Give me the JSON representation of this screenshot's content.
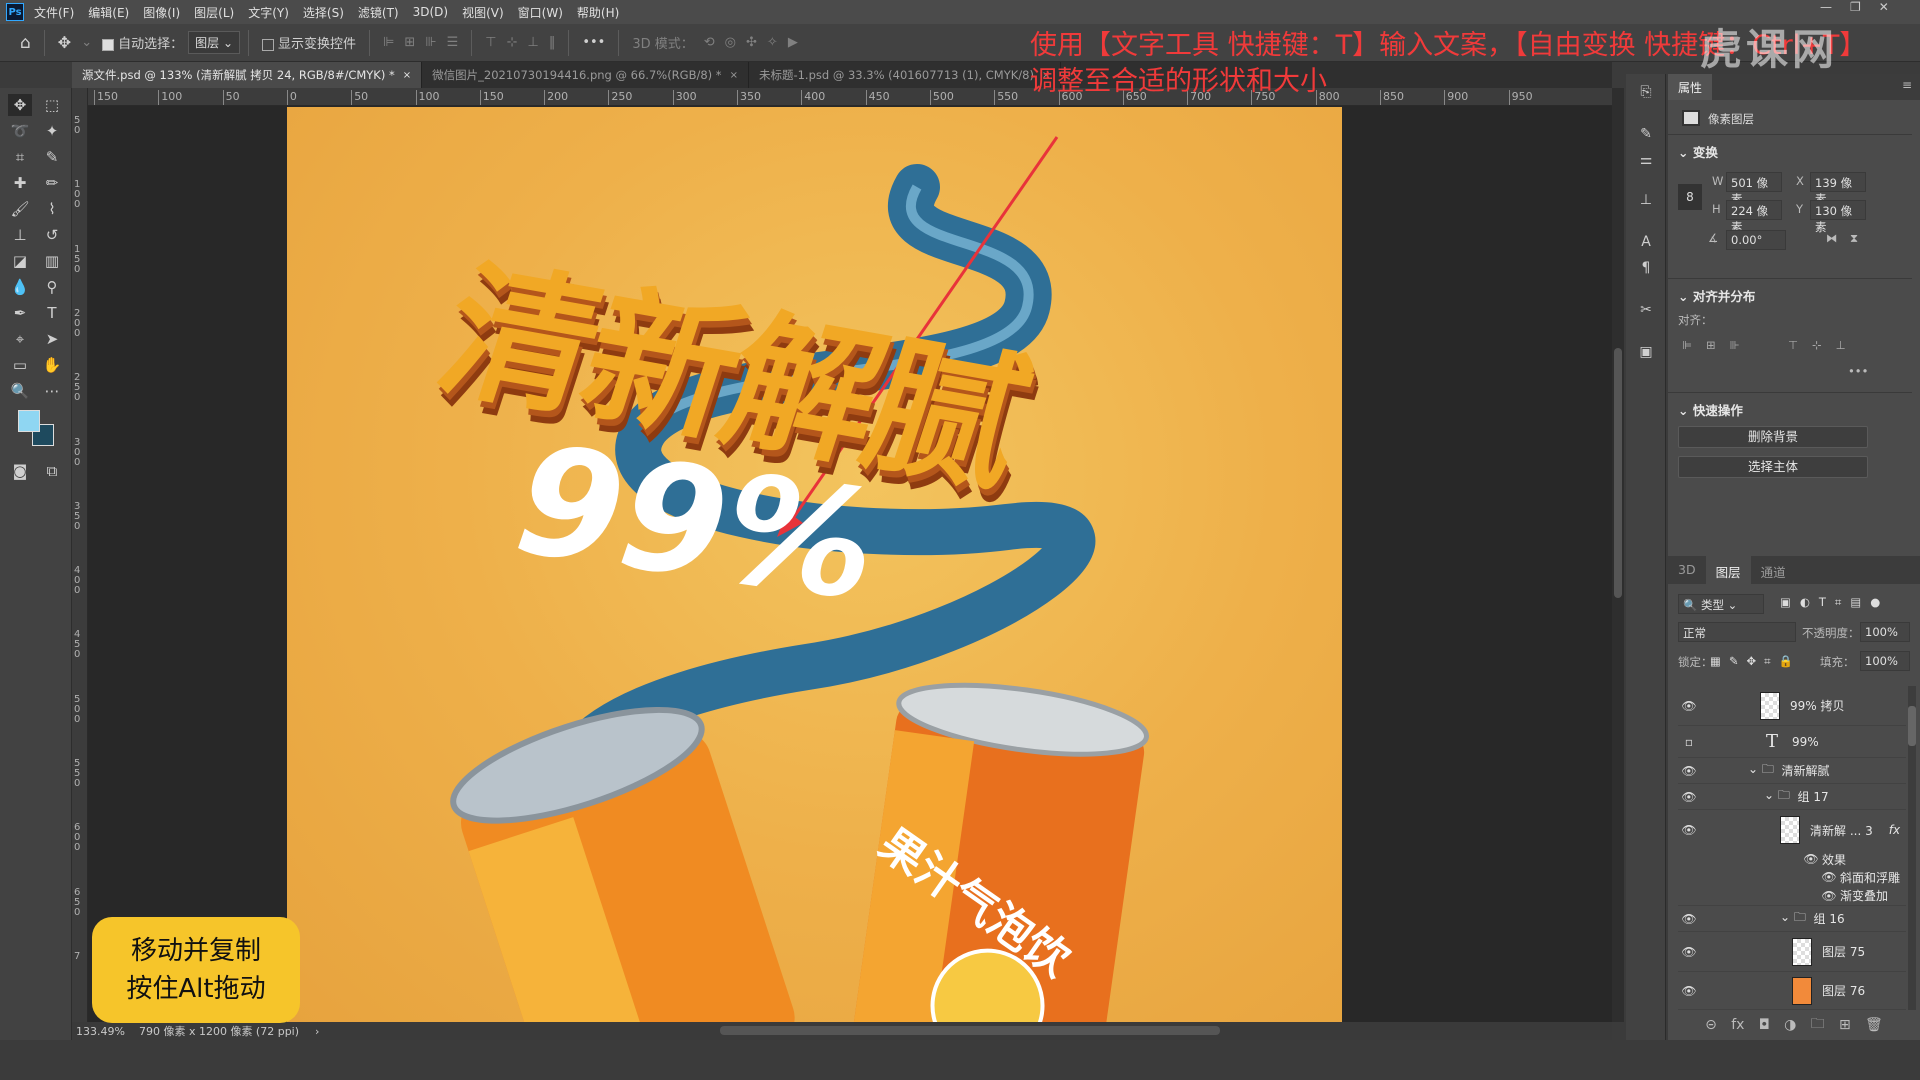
{
  "app": {
    "logo": "Ps"
  },
  "menu": [
    "文件(F)",
    "编辑(E)",
    "图像(I)",
    "图层(L)",
    "文字(Y)",
    "选择(S)",
    "滤镜(T)",
    "3D(D)",
    "视图(V)",
    "窗口(W)",
    "帮助(H)"
  ],
  "options": {
    "auto_select_label": "自动选择：",
    "auto_select_checked": true,
    "auto_select_target": "图层",
    "show_transform_label": "显示变换控件",
    "show_transform_checked": false,
    "mode_3d_label": "3D 模式：",
    "more": "•••"
  },
  "tabs": [
    {
      "label": "源文件.psd @ 133% (清新解腻 拷贝 24, RGB/8#/CMYK) *",
      "active": true
    },
    {
      "label": "微信图片_20210730194416.png @ 66.7%(RGB/8) *",
      "active": false
    },
    {
      "label": "未标题-1.psd @ 33.3% (401607713 (1), CMYK/8)",
      "active": false
    }
  ],
  "ruler": {
    "h_labels": [
      "150",
      "100",
      "50",
      "0",
      "50",
      "100",
      "150",
      "200",
      "250",
      "300",
      "350",
      "400",
      "450",
      "500",
      "550",
      "600",
      "650",
      "700",
      "750",
      "800",
      "850",
      "900",
      "950"
    ],
    "v_labels": [
      "50",
      "100",
      "150",
      "200",
      "250",
      "300",
      "350",
      "400",
      "450",
      "500",
      "550",
      "600",
      "650",
      "7"
    ]
  },
  "artwork": {
    "headline": "清新解腻",
    "percent": "99%",
    "can_text": "果汁气泡饮",
    "colors": {
      "bg": "#eeb04a",
      "ribbon": "#2f6f96",
      "headline": "#f1a825"
    }
  },
  "status": {
    "zoom": "133.49%",
    "doc_info": "790 像素 x 1200 像素 (72 ppi)",
    "arrow": "›"
  },
  "annotation": "使用【文字工具 快捷键：T】输入文案，【自由变换 快捷键：Ctrl+T】\n调整至合适的形状和大小",
  "caption": {
    "line1": "移动并复制",
    "line2": "按住Alt拖动"
  },
  "watermark": "虎课网",
  "properties": {
    "tab": "属性",
    "layer_type": "像素图层",
    "transform": {
      "title": "变换",
      "w_label": "W",
      "w": "501 像素",
      "h_label": "H",
      "h": "224 像素",
      "x_label": "X",
      "x": "139 像素",
      "y_label": "Y",
      "y": "130 像素",
      "angle": "0.00°"
    },
    "align": {
      "title": "对齐并分布",
      "label": "对齐：",
      "more": "•••"
    },
    "quick": {
      "title": "快速操作",
      "remove_bg": "删除背景",
      "select_subject": "选择主体"
    }
  },
  "layers": {
    "tabs": [
      {
        "label": "3D",
        "active": false
      },
      {
        "label": "图层",
        "active": true
      },
      {
        "label": "通道",
        "active": false
      }
    ],
    "filter": "类型",
    "blend_mode": "正常",
    "opacity_label": "不透明度：",
    "opacity": "100%",
    "lock_label": "锁定：",
    "fill_label": "填充：",
    "fill": "100%",
    "items": [
      {
        "name": "99% 拷贝",
        "type": "smart",
        "visible": true
      },
      {
        "name": "99%",
        "type": "text",
        "visible": false
      },
      {
        "name": "清新解腻",
        "type": "group",
        "visible": true
      },
      {
        "name": "组 17",
        "type": "group",
        "visible": true
      },
      {
        "name": "清新解 ... 3",
        "type": "smart",
        "visible": true,
        "fx": "fx"
      },
      {
        "name": "效果",
        "type": "effects",
        "visible": true
      },
      {
        "name": "斜面和浮雕",
        "type": "effect",
        "visible": true
      },
      {
        "name": "渐变叠加",
        "type": "effect",
        "visible": true
      },
      {
        "name": "组 16",
        "type": "group",
        "visible": true
      },
      {
        "name": "图层 75",
        "type": "pixel",
        "visible": true
      },
      {
        "name": "图层 76",
        "type": "pixel",
        "visible": true
      }
    ]
  }
}
